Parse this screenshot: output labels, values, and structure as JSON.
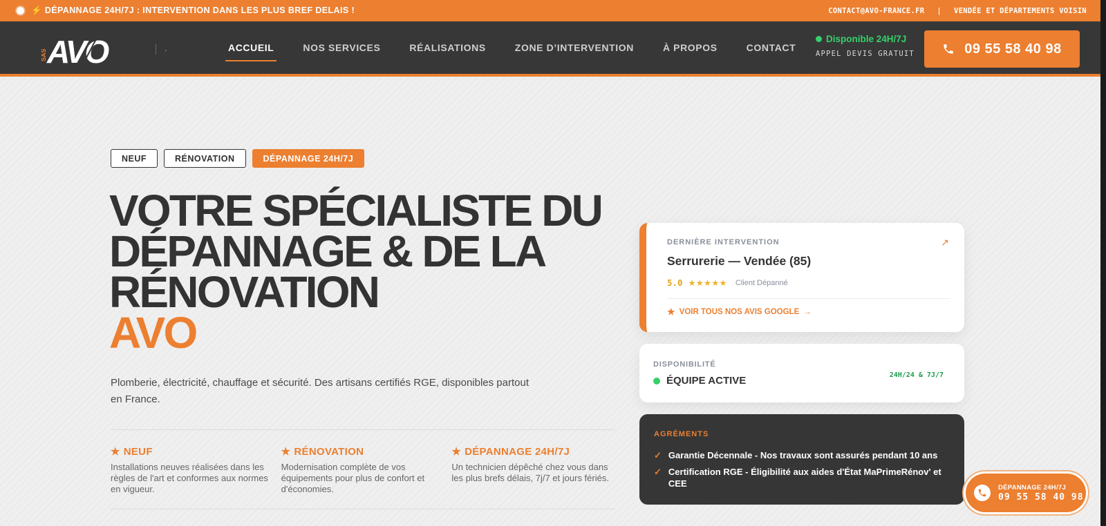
{
  "colors": {
    "accent": "#ec7f30",
    "dark": "#373737",
    "green": "#35d06a",
    "star": "#f2b01e"
  },
  "topbar": {
    "announcement": "⚡ DÉPANNAGE 24H/7J : INTERVENTION DANS LES PLUS BREF DELAIS !",
    "email": "CONTACT@AVO-FRANCE.FR",
    "separator": "|",
    "zone": "VENDÉE ET DÉPARTEMENTS VOISIN"
  },
  "header": {
    "logo": {
      "text": "AVO",
      "prefix": "SAS"
    },
    "logo_suffix": ".",
    "nav": [
      {
        "label": "ACCUEIL"
      },
      {
        "label": "NOS SERVICES"
      },
      {
        "label": "RÉALISATIONS"
      },
      {
        "label": "ZONE D’INTERVENTION"
      },
      {
        "label": "À PROPOS"
      },
      {
        "label": "CONTACT"
      }
    ],
    "availability": "Disponible 24H/7J",
    "availability_sub": "APPEL DEVIS GRATUIT",
    "phone": "09 55 58 40 98",
    "phone_icon": "phone-icon"
  },
  "hero": {
    "tags": [
      "NEUF",
      "RÉNOVATION",
      "DÉPANNAGE 24H/7J"
    ],
    "title_lines": [
      "VOTRE SPÉCIALISTE DU",
      "DÉPANNAGE & DE LA",
      "RÉNOVATION"
    ],
    "title_accent": "AVO",
    "description": "Plomberie, électricité, chauffage et sécurité. Des artisans certifiés RGE, disponibles partout en France."
  },
  "features": [
    {
      "title": "NEUF",
      "text": "Installations neuves réalisées dans les règles de l'art et conformes aux normes en vigueur."
    },
    {
      "title": "RÉNOVATION",
      "text": "Modernisation complète de vos équipements pour plus de confort et d'économies."
    },
    {
      "title": "DÉPANNAGE 24H/7J",
      "text": "Un technicien dépêché chez vous dans les plus brefs délais, 7j/7 et jours fériés."
    }
  ],
  "intervention_card": {
    "label": "DERNIÈRE INTERVENTION",
    "title": "Serrurerie — Vendée (85)",
    "score": "5.0",
    "stars": "★★★★★",
    "client": "Client Dépanné",
    "reviews_link": "VOIR TOUS NOS AVIS GOOGLE"
  },
  "availability_card": {
    "label": "DISPONIBILITÉ",
    "status": "ÉQUIPE ACTIVE",
    "hours": "24H/24 & 7J/7"
  },
  "accreditations_card": {
    "label": "AGRÉMENTS",
    "items": [
      "Garantie Décennale - Nos travaux sont assurés pendant 10 ans",
      "Certification RGE - Éligibilité aux aides d'État MaPrimeRénov' et CEE"
    ]
  },
  "floating_button": {
    "label": "DÉPANNAGE 24H/7J",
    "phone": "09 55 58 40 98"
  }
}
